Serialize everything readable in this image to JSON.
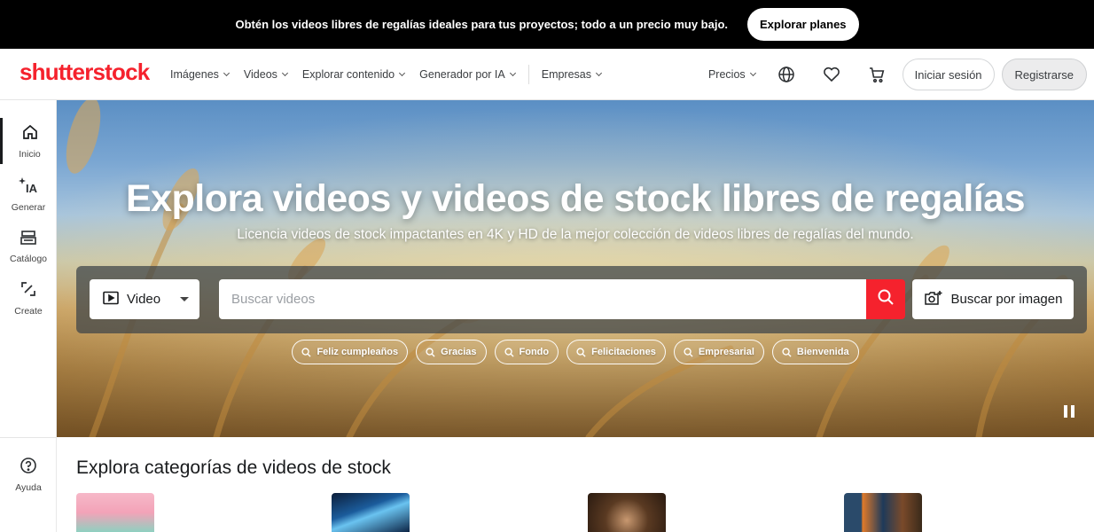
{
  "promo": {
    "text": "Obtén los videos libres de regalías ideales para tus proyectos; todo a un precio muy bajo.",
    "cta": "Explorar planes"
  },
  "header": {
    "logo": "shutterstock",
    "nav": [
      {
        "label": "Imágenes",
        "dropdown": true
      },
      {
        "label": "Videos",
        "dropdown": true
      },
      {
        "label": "Explorar contenido",
        "dropdown": true
      },
      {
        "label": "Generador por IA",
        "dropdown": true
      },
      {
        "label": "Empresas",
        "dropdown": true
      }
    ],
    "pricing": "Precios",
    "icons": [
      "globe-icon",
      "heart-icon",
      "cart-icon"
    ],
    "login": "Iniciar sesión",
    "register": "Registrarse"
  },
  "sidebar": {
    "items": [
      {
        "label": "Inicio",
        "icon": "home-icon",
        "active": true
      },
      {
        "label": "Generar",
        "icon": "ai-sparkle-icon",
        "active": false
      },
      {
        "label": "Catálogo",
        "icon": "catalog-icon",
        "active": false
      },
      {
        "label": "Create",
        "icon": "edit-icon",
        "active": false
      }
    ],
    "help": {
      "label": "Ayuda",
      "icon": "help-icon"
    }
  },
  "hero": {
    "title": "Explora videos y videos de stock libres de regalías",
    "subtitle": "Licencia videos de stock impactantes en 4K y HD de la mejor colección de videos libres de regalías del mundo.",
    "search": {
      "type_selected": "Video",
      "placeholder": "Buscar videos",
      "image_search": "Buscar por imagen"
    },
    "chips": [
      "Feliz cumpleaños",
      "Gracias",
      "Fondo",
      "Felicitaciones",
      "Empresarial",
      "Bienvenida"
    ]
  },
  "categories": {
    "title": "Explora categorías de videos de stock"
  },
  "colors": {
    "brand_red": "#f5222d",
    "promo_bg": "#000000",
    "text_dark": "#191b1d"
  }
}
